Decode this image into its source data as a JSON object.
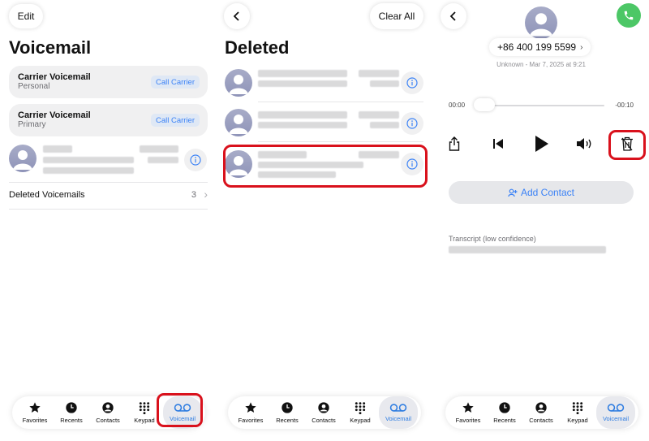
{
  "panel1": {
    "edit_label": "Edit",
    "title": "Voicemail",
    "carrier_rows": [
      {
        "title": "Carrier Voicemail",
        "subtitle": "Personal",
        "action": "Call Carrier"
      },
      {
        "title": "Carrier Voicemail",
        "subtitle": "Primary",
        "action": "Call Carrier"
      }
    ],
    "deleted_label": "Deleted Voicemails",
    "deleted_count": "3",
    "deleted_chevron": "›"
  },
  "panel2": {
    "clear_all_label": "Clear All",
    "title": "Deleted"
  },
  "panel3": {
    "phone_number": "+86 400 199 5599",
    "number_chevron": "›",
    "meta": "Unknown - Mar 7, 2025 at 9:21",
    "time_elapsed": "00:00",
    "time_remaining": "-00:10",
    "add_contact_label": "Add Contact",
    "transcript_label": "Transcript (low confidence)"
  },
  "tabbar": {
    "tabs": [
      {
        "label": "Favorites",
        "icon": "star-icon"
      },
      {
        "label": "Recents",
        "icon": "clock-icon"
      },
      {
        "label": "Contacts",
        "icon": "person-circle-icon"
      },
      {
        "label": "Keypad",
        "icon": "keypad-icon"
      },
      {
        "label": "Voicemail",
        "icon": "voicemail-icon",
        "active": true
      }
    ]
  },
  "colors": {
    "accent": "#3b82f6",
    "highlight": "#d9111c",
    "call_green": "#4cc766"
  }
}
